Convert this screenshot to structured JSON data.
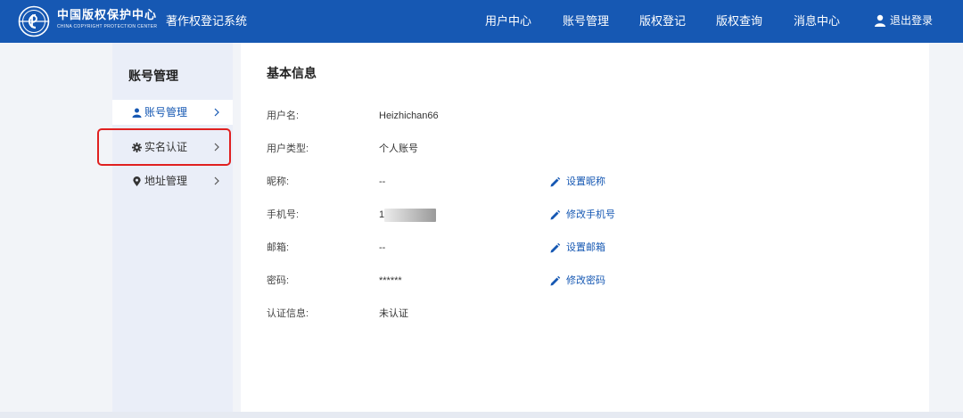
{
  "header": {
    "logo_cn": "中国版权保护中心",
    "logo_en": "CHINA COPYRIGHT PROTECTION CENTER",
    "system_title": "著作权登记系统",
    "nav": [
      "用户中心",
      "账号管理",
      "版权登记",
      "版权查询",
      "消息中心"
    ],
    "logout": "退出登录",
    "color": "#1658b3"
  },
  "sidebar": {
    "title": "账号管理",
    "items": [
      {
        "label": "账号管理",
        "icon": "user-icon",
        "active": true
      },
      {
        "label": "实名认证",
        "icon": "gear-icon",
        "active": false
      },
      {
        "label": "地址管理",
        "icon": "location-pin-icon",
        "active": false
      }
    ],
    "highlight_color": "#e02020"
  },
  "main": {
    "title": "基本信息",
    "rows": [
      {
        "label": "用户名:",
        "value": "Heizhichan66",
        "action": ""
      },
      {
        "label": "用户类型:",
        "value": "个人账号",
        "action": ""
      },
      {
        "label": "昵称:",
        "value": "--",
        "action": "设置昵称"
      },
      {
        "label": "手机号:",
        "value": "1",
        "action": "修改手机号",
        "masked": true
      },
      {
        "label": "邮箱:",
        "value": "--",
        "action": "设置邮箱"
      },
      {
        "label": "密码:",
        "value": "******",
        "action": "修改密码"
      },
      {
        "label": "认证信息:",
        "value": "未认证",
        "action": ""
      }
    ]
  }
}
